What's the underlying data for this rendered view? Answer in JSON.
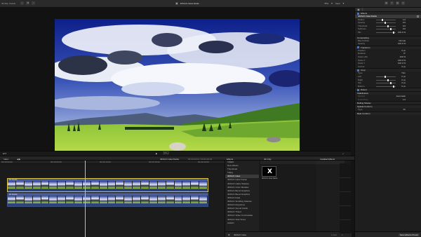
{
  "topbar": {
    "library": "4K 60s, Clouds",
    "project": "4KPerfx Glow Darks",
    "zoom": "78%",
    "view": "View"
  },
  "viewer": {
    "timecode": "302"
  },
  "inspector": {
    "effects_label": "Effects",
    "effect_name": "4KPerfx Glow Darks",
    "params": [
      {
        "label": "Radius",
        "value": "1.0"
      },
      {
        "label": "Opacity",
        "value": "0.0"
      },
      {
        "label": "Threshold",
        "value": "0.0"
      },
      {
        "label": "Softness",
        "value": "0.0"
      },
      {
        "label": "Mix",
        "value": "100.0 %"
      }
    ],
    "compositing": {
      "title": "Compositing",
      "blend_mode_label": "Blend Mode",
      "blend_mode_value": "Normal",
      "opacity_label": "Opacity",
      "opacity_value": "100.0 %"
    },
    "transform": {
      "title": "Transform",
      "rows": [
        {
          "label": "Position",
          "value": "0 px"
        },
        {
          "label": "Rotation",
          "value": "0°"
        },
        {
          "label": "Scale (All)",
          "value": "100 %"
        },
        {
          "label": "Scale X",
          "value": "100.0 %"
        },
        {
          "label": "Scale Y",
          "value": "100.0 %"
        },
        {
          "label": "Anchor",
          "value": "0 px"
        }
      ]
    },
    "crop": {
      "title": "Crop",
      "rows": [
        {
          "label": "Type",
          "value": "Trim"
        },
        {
          "label": "Left",
          "value": "0 px"
        },
        {
          "label": "Right",
          "value": "0 px"
        },
        {
          "label": "Top",
          "value": "0 px"
        },
        {
          "label": "Bottom",
          "value": "0 px"
        }
      ]
    },
    "distort_title": "Distort",
    "stabilization_title": "Stabilization",
    "stab_rows": [
      "Method",
      "Smoothing"
    ],
    "stab_values": [
      "Automatic",
      "1.0"
    ],
    "rolling_shutter": "Rolling Shutter",
    "spatial_conform": "Spatial Conform",
    "spatial_type_label": "Type",
    "spatial_type_value": "Fit",
    "rate_conform": "Rate Conform",
    "save_button": "Save Effects Preset"
  },
  "timeline": {
    "index_label": "Index",
    "project_label": "4KPerfx Glow Darks",
    "duration": "00:00:23:04 / 00:00:23:04",
    "ruler": [
      "00:00:00:00",
      "00:00:05:00",
      "00:00:10:00",
      "00:00:15:00",
      "00:00:20:00"
    ],
    "clip1_name": "4K Clouds",
    "clip2_name": "4K Clouds"
  },
  "effects_browser": {
    "header": "Effects",
    "search_tab": "4K Only",
    "installed": "Installed Effects",
    "categories": [
      "VIDEO",
      "New effects",
      "Thumbnail",
      "Tilting",
      "4KPerfx Glow",
      "4KPerfx Glow Fusion",
      "4KPerfx Glass Shadow",
      "4KPerfx Color Shadow",
      "4KPerfx Boost Graphics",
      "4KPerfx Boost Graphics",
      "4KPerfx Fade",
      "4KPerfx Scrolling Shadow",
      "4KPerfx Dropshow",
      "4KPerfx Sound Fields",
      "4KPerfx Tinted",
      "4KPerfx Video Combostate",
      "4KPerfx Vital Tones",
      "AUDIO"
    ],
    "selected_index": 4,
    "tile_label": "4KPerfx Glow Darks",
    "footer_item": "4KPerfx Glow",
    "count": "1 item"
  }
}
